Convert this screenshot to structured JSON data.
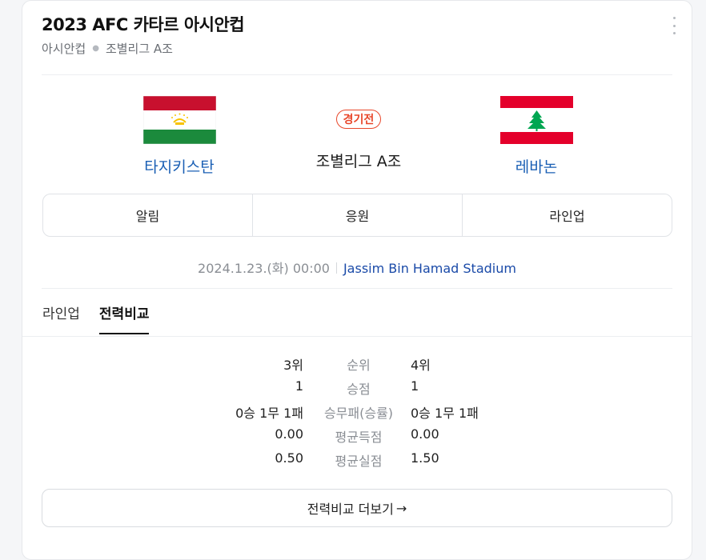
{
  "header": {
    "title": "2023 AFC 카타르 아시안컵",
    "breadcrumb": [
      "아시안컵",
      "조별리그 A조"
    ]
  },
  "match": {
    "home": {
      "name": "타지키스탄",
      "flag": "tajikistan-flag"
    },
    "away": {
      "name": "레바논",
      "flag": "lebanon-flag"
    },
    "status_badge": "경기전",
    "group": "조별리그 A조",
    "datetime": "2024.1.23.(화) 00:00",
    "stadium": "Jassim Bin Hamad Stadium"
  },
  "action_tabs": [
    "알림",
    "응원",
    "라인업"
  ],
  "sub_tabs": [
    {
      "label": "라인업",
      "active": false
    },
    {
      "label": "전력비교",
      "active": true
    }
  ],
  "stats": [
    {
      "label": "순위",
      "home": "3위",
      "away": "4위"
    },
    {
      "label": "승점",
      "home": "1",
      "away": "1"
    },
    {
      "label": "승무패(승률)",
      "home": "0승 1무 1패",
      "away": "0승 1무 1패"
    },
    {
      "label": "평균득점",
      "home": "0.00",
      "away": "0.00"
    },
    {
      "label": "평균실점",
      "home": "0.50",
      "away": "1.50"
    }
  ],
  "more_button": {
    "label": "전력비교 더보기",
    "icon": "arrow-right-icon"
  },
  "colors": {
    "accent_blue": "#1a5fb4",
    "badge_red": "#e8472b",
    "stadium_blue": "#1a4aa8"
  }
}
